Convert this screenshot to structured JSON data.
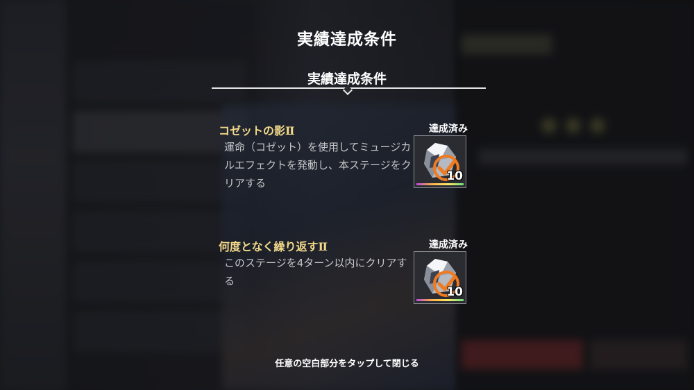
{
  "popup": {
    "title": "実績達成条件",
    "section_title": "実績達成条件",
    "close_hint": "任意の空白部分をタップして閉じる"
  },
  "achievements": [
    {
      "name": "コゼットの影Ⅱ",
      "description": "運命（コゼット）を使用してミュージカルエフェクトを発動し、本ステージをクリアする",
      "status": "達成済み",
      "reward": {
        "icon": "crystal-icon",
        "count": "10",
        "claimed": true
      }
    },
    {
      "name": "何度となく繰り返すⅡ",
      "description": "このステージを4ターン以内にクリアする",
      "status": "達成済み",
      "reward": {
        "icon": "crystal-icon",
        "count": "10",
        "claimed": true
      }
    }
  ],
  "colors": {
    "achievement_name": "#f3d98a",
    "check_mark": "#f07a1f",
    "text": "#c7c7c9"
  }
}
